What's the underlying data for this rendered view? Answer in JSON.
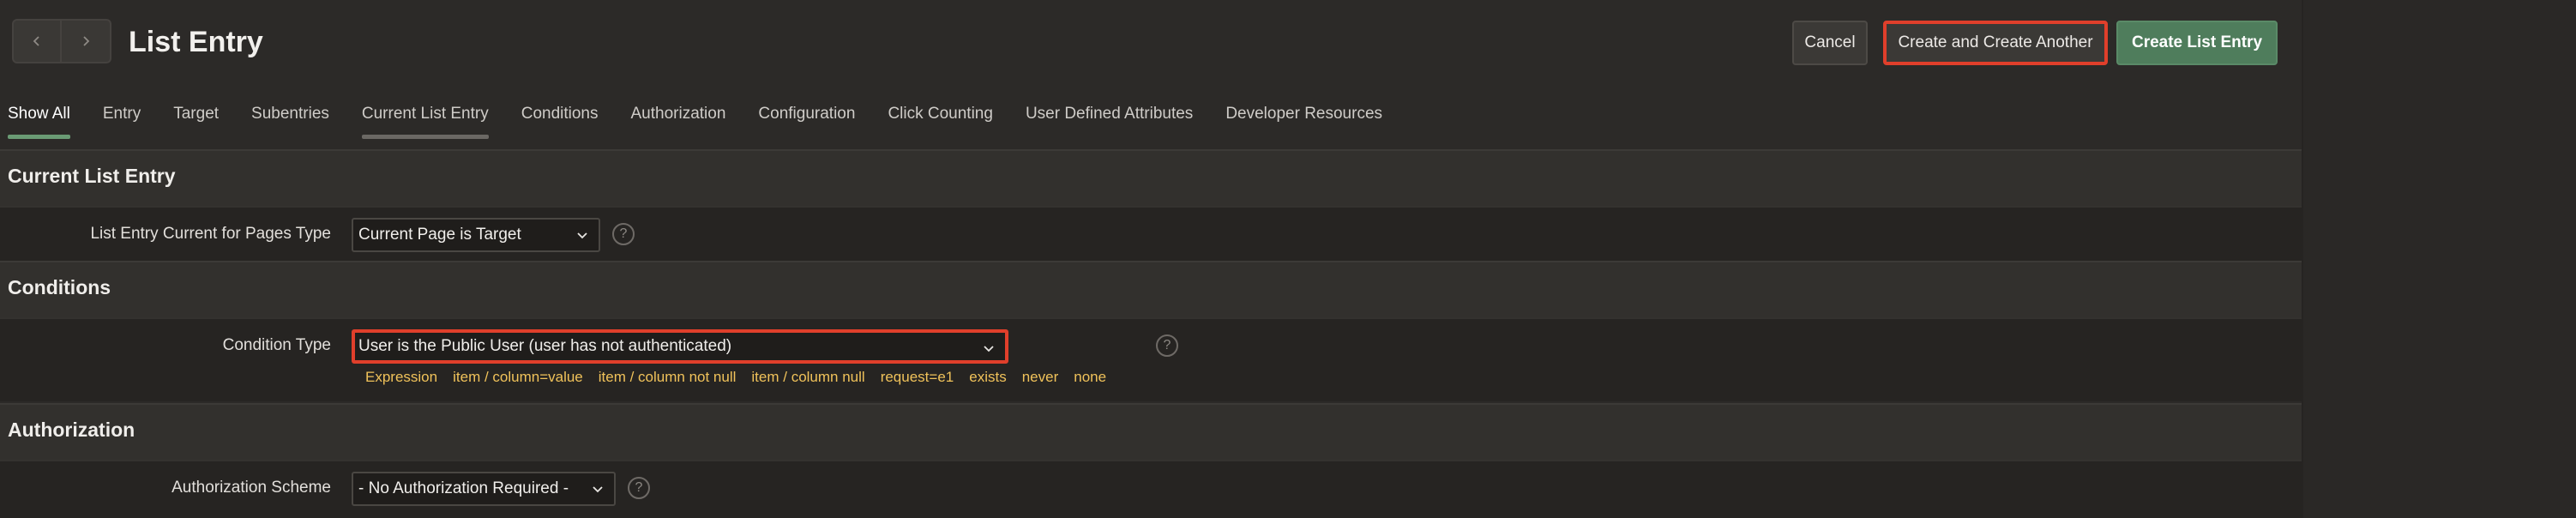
{
  "header": {
    "title": "List Entry",
    "nav": {
      "prev_icon": "chevron-left-icon",
      "next_icon": "chevron-right-icon"
    },
    "buttons": {
      "cancel": "Cancel",
      "create_another": "Create and Create Another",
      "create": "Create List Entry"
    }
  },
  "tabs": [
    {
      "label": "Show All",
      "state": "active"
    },
    {
      "label": "Entry"
    },
    {
      "label": "Target"
    },
    {
      "label": "Subentries"
    },
    {
      "label": "Current List Entry",
      "state": "current"
    },
    {
      "label": "Conditions"
    },
    {
      "label": "Authorization"
    },
    {
      "label": "Configuration"
    },
    {
      "label": "Click Counting"
    },
    {
      "label": "User Defined Attributes"
    },
    {
      "label": "Developer Resources"
    }
  ],
  "sections": {
    "current_list_entry": {
      "title": "Current List Entry",
      "field_label": "List Entry Current for Pages Type",
      "value": "Current Page is Target"
    },
    "conditions": {
      "title": "Conditions",
      "field_label": "Condition Type",
      "value": "User is the Public User (user has not authenticated)",
      "quick_picks": [
        "Expression",
        "item / column=value",
        "item / column not null",
        "item / column null",
        "request=e1",
        "exists",
        "never",
        "none"
      ]
    },
    "authorization": {
      "title": "Authorization",
      "field_label": "Authorization Scheme",
      "value": "- No Authorization Required -"
    }
  },
  "help_symbol": "?",
  "colors": {
    "accent_green": "#4f7d5c",
    "highlight_red": "#e03f2b",
    "link_yellow": "#f0c25a",
    "background": "#2c2a28"
  }
}
